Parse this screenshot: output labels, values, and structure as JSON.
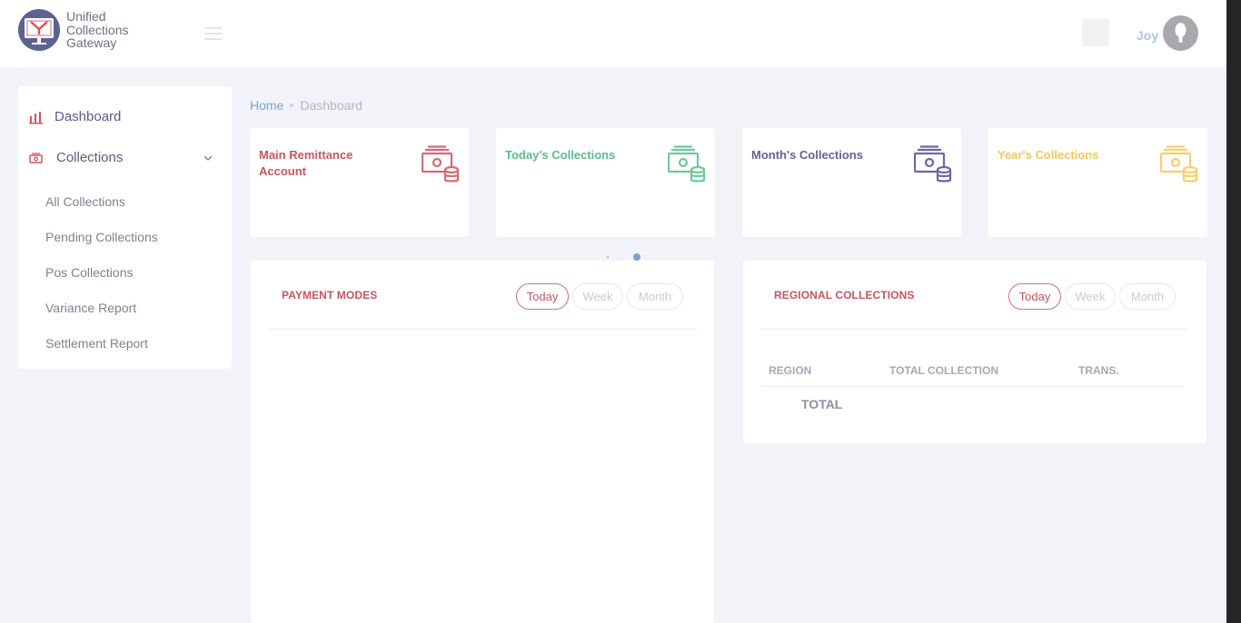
{
  "header": {
    "logo_line1": "Unified",
    "logo_line2": "Collections",
    "logo_line3": "Gateway",
    "user_name": "Joy"
  },
  "sidebar": {
    "items": [
      {
        "label": "Dashboard",
        "icon": "bar-chart-icon",
        "active": true
      },
      {
        "label": "Collections",
        "icon": "money-icon",
        "expanded": true
      }
    ],
    "sub_items": [
      {
        "label": "All Collections"
      },
      {
        "label": "Pending Collections"
      },
      {
        "label": "Pos Collections"
      },
      {
        "label": "Variance Report"
      },
      {
        "label": "Settlement Report"
      }
    ]
  },
  "breadcrumb": {
    "home": "Home",
    "current": "Dashboard"
  },
  "stat_cards": [
    {
      "title": "Main Remittance Account",
      "color": "#c9545f",
      "icon": "money-stack-icon"
    },
    {
      "title": "Today's Collections",
      "color": "#55bf8a",
      "icon": "money-stack-icon"
    },
    {
      "title": "Month's Collections",
      "color": "#65619a",
      "icon": "money-stack-icon"
    },
    {
      "title": "Year's Collections",
      "color": "#f7c755",
      "icon": "money-stack-icon"
    }
  ],
  "payment_modes": {
    "title": "PAYMENT MODES",
    "tabs": [
      {
        "label": "Today",
        "active": true
      },
      {
        "label": "Week",
        "active": false
      },
      {
        "label": "Month",
        "active": false
      }
    ]
  },
  "regional": {
    "title": "REGIONAL COLLECTIONS",
    "tabs": [
      {
        "label": "Today",
        "active": true
      },
      {
        "label": "Week",
        "active": false
      },
      {
        "label": "Month",
        "active": false
      }
    ],
    "columns": [
      "REGION",
      "TOTAL COLLECTION",
      "TRANS."
    ],
    "total_label": "TOTAL"
  },
  "colors": {
    "accent_red": "#c9545f",
    "link_blue": "#7aa3d4",
    "background": "#f2f3f8"
  }
}
